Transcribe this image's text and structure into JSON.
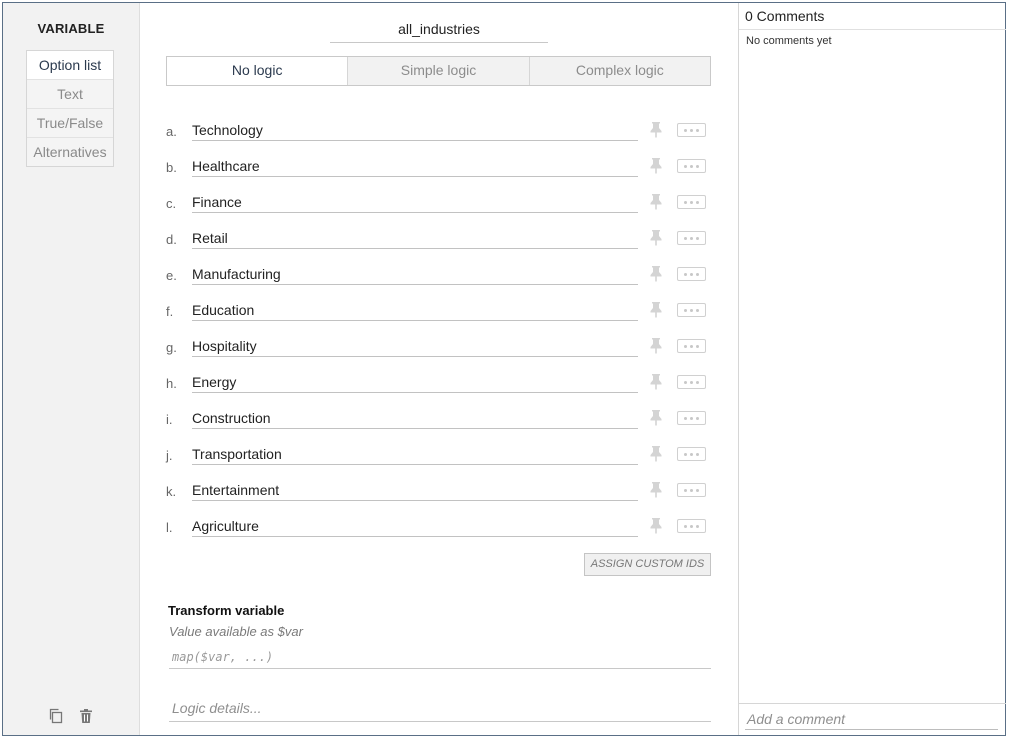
{
  "rail": {
    "title": "VARIABLE",
    "types": [
      "Option list",
      "Text",
      "True/False",
      "Alternatives"
    ],
    "active_type": 0,
    "actions": [
      "copy-icon",
      "trash-icon"
    ]
  },
  "editor": {
    "variable_name": "all_industries",
    "logic_tabs": [
      "No logic",
      "Simple logic",
      "Complex logic"
    ],
    "active_logic_tab": 0,
    "options": [
      {
        "letter": "a.",
        "label": "Technology"
      },
      {
        "letter": "b.",
        "label": "Healthcare"
      },
      {
        "letter": "c.",
        "label": "Finance"
      },
      {
        "letter": "d.",
        "label": "Retail"
      },
      {
        "letter": "e.",
        "label": "Manufacturing"
      },
      {
        "letter": "f.",
        "label": "Education"
      },
      {
        "letter": "g.",
        "label": "Hospitality"
      },
      {
        "letter": "h.",
        "label": "Energy"
      },
      {
        "letter": "i.",
        "label": "Construction"
      },
      {
        "letter": "j.",
        "label": "Transportation"
      },
      {
        "letter": "k.",
        "label": "Entertainment"
      },
      {
        "letter": "l.",
        "label": "Agriculture"
      }
    ],
    "option_icons": [
      "pin-icon",
      "more-options-icon"
    ],
    "assign_button": "ASSIGN CUSTOM IDS",
    "transform": {
      "title": "Transform variable",
      "subtitle": "Value available as $var",
      "placeholder": "map($var, ...)"
    },
    "logic_details_placeholder": "Logic details..."
  },
  "comments": {
    "header": "0 Comments",
    "empty_text": "No comments yet",
    "input_placeholder": "Add a comment"
  }
}
